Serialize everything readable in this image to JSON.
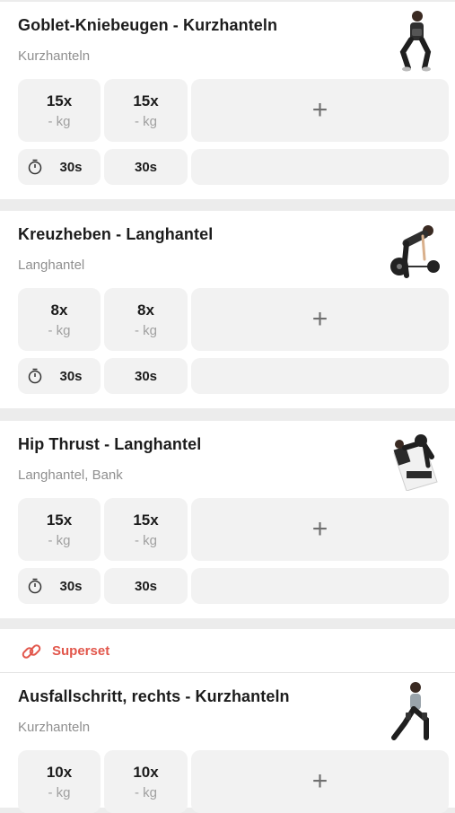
{
  "theme": {
    "accent": "#e2574c",
    "divider": "#ececec",
    "tile": "#f2f2f2"
  },
  "exercises": [
    {
      "title": "Goblet-Kniebeugen - Kurzhanteln",
      "equipment": "Kurzhanteln",
      "thumbnail_icon": "goblet-squat-figure",
      "sets": [
        {
          "reps": "15x",
          "weight": "- kg"
        },
        {
          "reps": "15x",
          "weight": "- kg"
        }
      ],
      "rests": [
        "30s",
        "30s"
      ]
    },
    {
      "title": "Kreuzheben - Langhantel",
      "equipment": "Langhantel",
      "thumbnail_icon": "deadlift-figure",
      "sets": [
        {
          "reps": "8x",
          "weight": "- kg"
        },
        {
          "reps": "8x",
          "weight": "- kg"
        }
      ],
      "rests": [
        "30s",
        "30s"
      ]
    },
    {
      "title": "Hip Thrust - Langhantel",
      "equipment": "Langhantel, Bank",
      "thumbnail_icon": "hip-thrust-figure",
      "sets": [
        {
          "reps": "15x",
          "weight": "- kg"
        },
        {
          "reps": "15x",
          "weight": "- kg"
        }
      ],
      "rests": [
        "30s",
        "30s"
      ]
    },
    {
      "title": "Ausfallschritt, rechts - Kurzhanteln",
      "equipment": "Kurzhanteln",
      "thumbnail_icon": "lunge-figure",
      "sets": [
        {
          "reps": "10x",
          "weight": "- kg"
        },
        {
          "reps": "10x",
          "weight": "- kg"
        }
      ],
      "rests": []
    }
  ],
  "add_set_symbol": "+",
  "superset": {
    "label": "Superset",
    "icon": "link-icon"
  }
}
